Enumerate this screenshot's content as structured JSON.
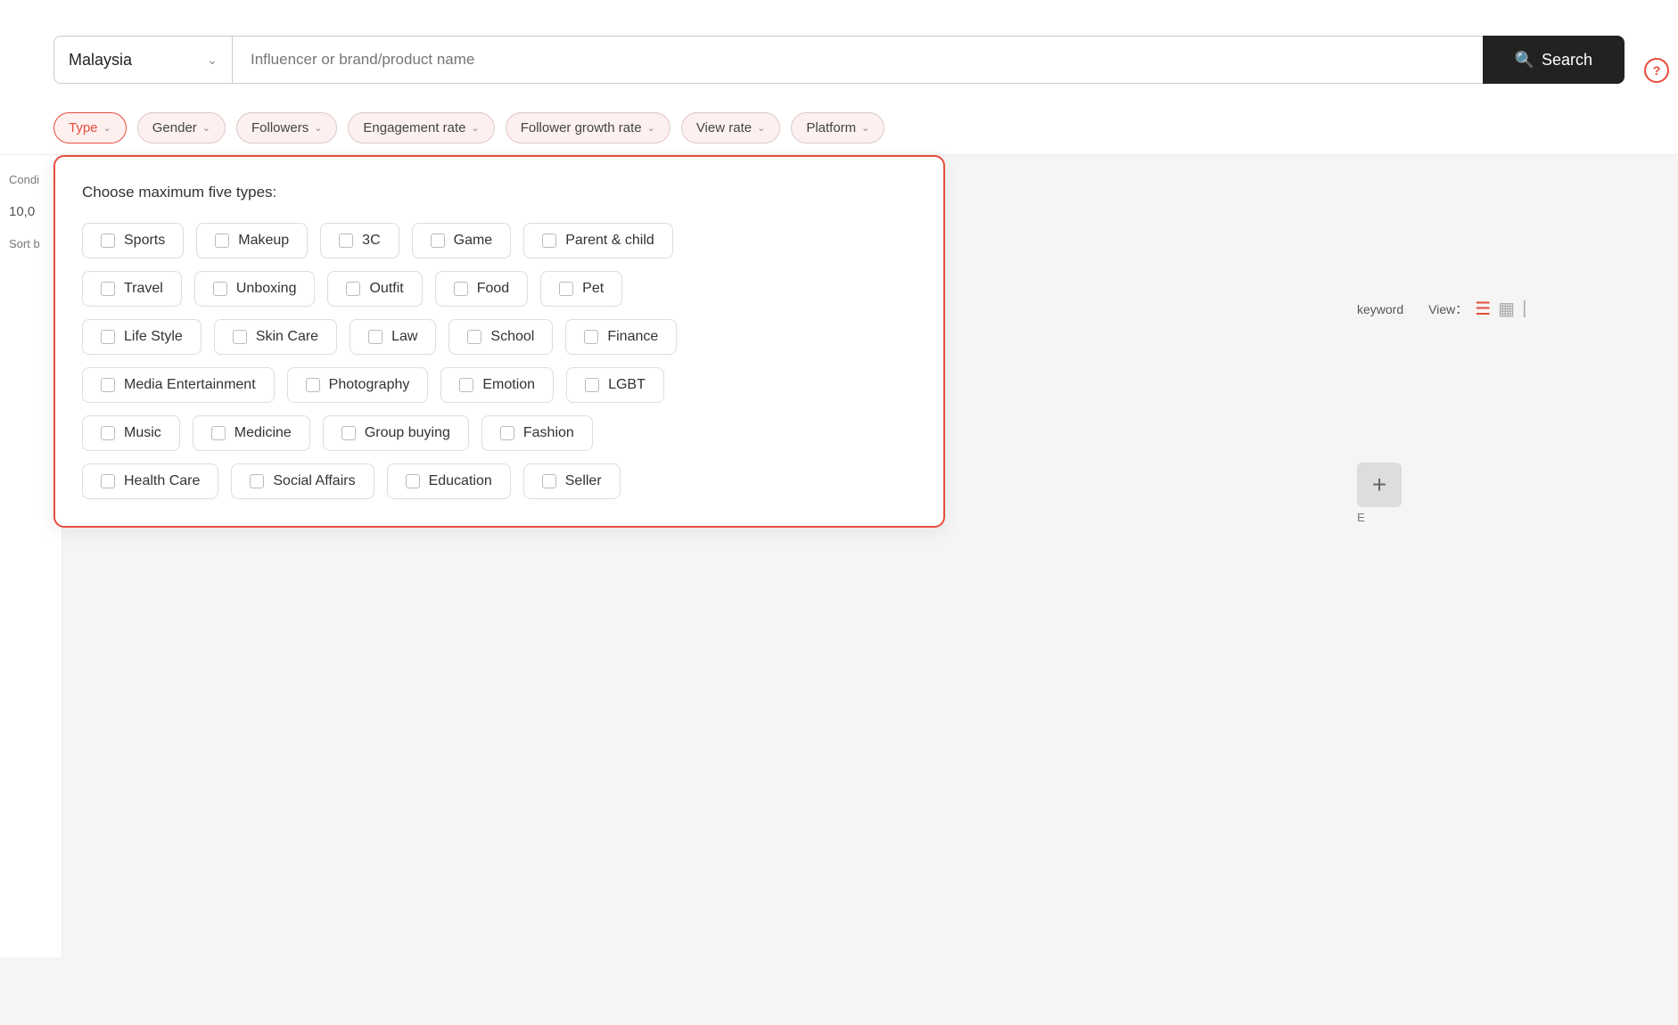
{
  "header": {
    "country_label": "Malaysia",
    "search_placeholder": "Influencer or brand/product name",
    "search_button_label": "Search"
  },
  "filters": {
    "type_label": "Type",
    "gender_label": "Gender",
    "followers_label": "Followers",
    "engagement_rate_label": "Engagement rate",
    "follower_growth_rate_label": "Follower growth rate",
    "view_rate_label": "View rate",
    "platform_label": "Platform"
  },
  "type_dropdown": {
    "instructions": "Choose maximum five types:",
    "rows": [
      [
        "Sports",
        "Makeup",
        "3C",
        "Game",
        "Parent & child"
      ],
      [
        "Travel",
        "Unboxing",
        "Outfit",
        "Food",
        "Pet"
      ],
      [
        "Life Style",
        "Skin Care",
        "Law",
        "School",
        "Finance"
      ],
      [
        "Media Entertainment",
        "Photography",
        "Emotion",
        "LGBT"
      ],
      [
        "Music",
        "Medicine",
        "Group buying",
        "Fashion"
      ],
      [
        "Health Care",
        "Social Affairs",
        "Education",
        "Seller"
      ]
    ]
  },
  "sidebar": {
    "conditions_label": "Condi",
    "count_label": "10,0",
    "sort_label": "Sort b"
  },
  "view_controls": {
    "keyword_label": "keyword",
    "view_label": "View："
  }
}
